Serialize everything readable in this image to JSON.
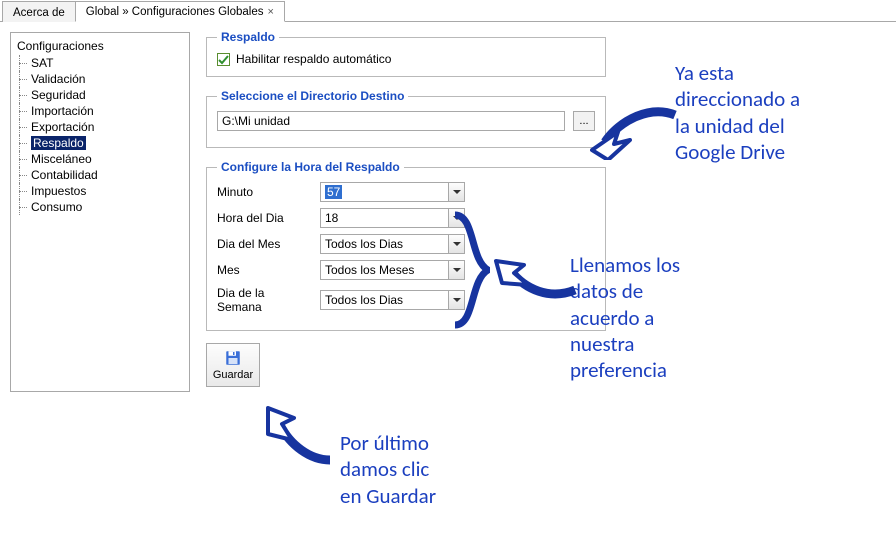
{
  "tabs": {
    "inactive": "Acerca de",
    "active": "Global » Configuraciones Globales",
    "close_glyph": "×"
  },
  "sidebar": {
    "root": "Configuraciones",
    "items": [
      {
        "label": "SAT"
      },
      {
        "label": "Validación"
      },
      {
        "label": "Seguridad"
      },
      {
        "label": "Importación"
      },
      {
        "label": "Exportación"
      },
      {
        "label": "Respaldo",
        "selected": true
      },
      {
        "label": "Misceláneo"
      },
      {
        "label": "Contabilidad"
      },
      {
        "label": "Impuestos"
      },
      {
        "label": "Consumo"
      }
    ]
  },
  "respaldo": {
    "legend": "Respaldo",
    "checkbox_label": "Habilitar respaldo automático",
    "checkbox_checked": true
  },
  "dest": {
    "legend": "Seleccione el Directorio Destino",
    "path": "G:\\Mi unidad",
    "browse": "..."
  },
  "schedule": {
    "legend": "Configure la Hora del Respaldo",
    "rows": [
      {
        "label": "Minuto",
        "value": "57",
        "highlight": true
      },
      {
        "label": "Hora del Dia",
        "value": "18"
      },
      {
        "label": "Dia del Mes",
        "value": "Todos los Dias"
      },
      {
        "label": "Mes",
        "value": "Todos los Meses"
      },
      {
        "label": "Dia de la Semana",
        "value": "Todos los Dias"
      }
    ]
  },
  "save": {
    "label": "Guardar"
  },
  "annotations": {
    "a1": "Ya esta\ndireccionado a\nla unidad del\nGoogle Drive",
    "a2": "Llenamos los\ndatos de\nacuerdo a\nnuestra\npreferencia",
    "a3": "Por  último\ndamos clic\nen Guardar"
  },
  "colors": {
    "accent": "#1b3fbf"
  }
}
